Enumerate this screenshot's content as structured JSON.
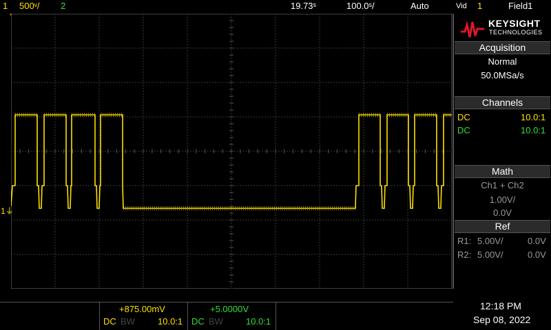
{
  "topbar": {
    "ch1_num": "1",
    "ch1_scale": "500ᵛ/",
    "ch2_num": "2",
    "time_pos": "19.73ˢ",
    "time_scale": "100.0ˢ/",
    "trigger_mode": "Auto",
    "trigger_type": "Vid",
    "trigger_source": "1",
    "trigger_field": "Field1"
  },
  "brand": {
    "name": "KEYSIGHT",
    "sub": "TECHNOLOGIES"
  },
  "acquisition": {
    "title": "Acquisition",
    "mode": "Normal",
    "rate": "50.0MSa/s"
  },
  "channels": {
    "title": "Channels",
    "rows": [
      {
        "coupling": "DC",
        "probe": "10.0:1"
      },
      {
        "coupling": "DC",
        "probe": "10.0:1"
      }
    ]
  },
  "math": {
    "title": "Math",
    "expr": "Ch1 + Ch2",
    "scale": "1.00V/",
    "offset": "0.0V"
  },
  "ref": {
    "title": "Ref",
    "rows": [
      {
        "label": "R1:",
        "scale": "5.00V/",
        "offset": "0.0V"
      },
      {
        "label": "R2:",
        "scale": "5.00V/",
        "offset": "0.0V"
      }
    ]
  },
  "bottom": {
    "ch1_offset": "+875.00mV",
    "ch2_offset": "+5.0000V",
    "ch1_coupling": "DC",
    "ch1_bw": "BW",
    "ch1_probe": "10.0:1",
    "ch2_coupling": "DC",
    "ch2_bw": "BW",
    "ch2_probe": "10.0:1",
    "time": "12:18 PM",
    "date": "Sep 08, 2022"
  },
  "ground_marker": "1",
  "colors": {
    "ch1": "#ffe100",
    "ch2": "#33e033",
    "grid": "#3a3a3a",
    "panel_title_bg": "#2b2b2b"
  }
}
